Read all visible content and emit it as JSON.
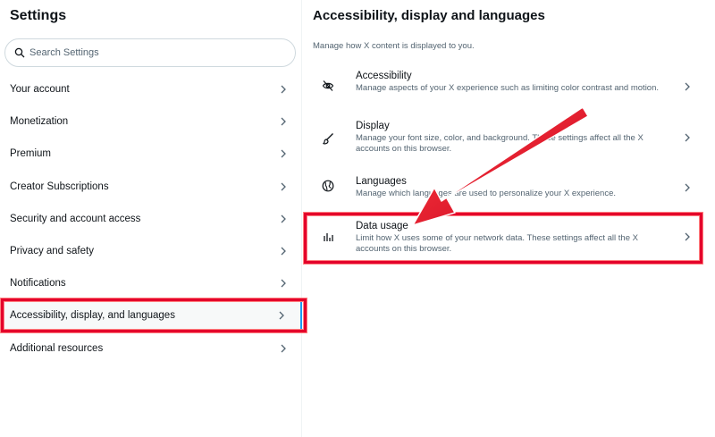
{
  "sidebar": {
    "title": "Settings",
    "search_placeholder": "Search Settings",
    "items": [
      {
        "label": "Your account"
      },
      {
        "label": "Monetization"
      },
      {
        "label": "Premium"
      },
      {
        "label": "Creator Subscriptions"
      },
      {
        "label": "Security and account access"
      },
      {
        "label": "Privacy and safety"
      },
      {
        "label": "Notifications"
      },
      {
        "label": "Accessibility, display, and languages",
        "active": true
      },
      {
        "label": "Additional resources"
      }
    ]
  },
  "main": {
    "title": "Accessibility, display and languages",
    "subtitle": "Manage how X content is displayed to you.",
    "rows": [
      {
        "title": "Accessibility",
        "desc": "Manage aspects of your X experience such as limiting color contrast and motion.",
        "icon": "eye-slash-icon"
      },
      {
        "title": "Display",
        "desc": "Manage your font size, color, and background. These settings affect all the X accounts on this browser.",
        "icon": "brush-icon"
      },
      {
        "title": "Languages",
        "desc": "Manage which languages are used to personalize your X experience.",
        "icon": "globe-icon"
      },
      {
        "title": "Data usage",
        "desc": "Limit how X uses some of your network data. These settings affect all the X accounts on this browser.",
        "icon": "bar-chart-icon"
      }
    ]
  },
  "colors": {
    "annotation": "#e4002b",
    "active_accent": "#1d9bf0",
    "secondary_text": "#536471"
  }
}
